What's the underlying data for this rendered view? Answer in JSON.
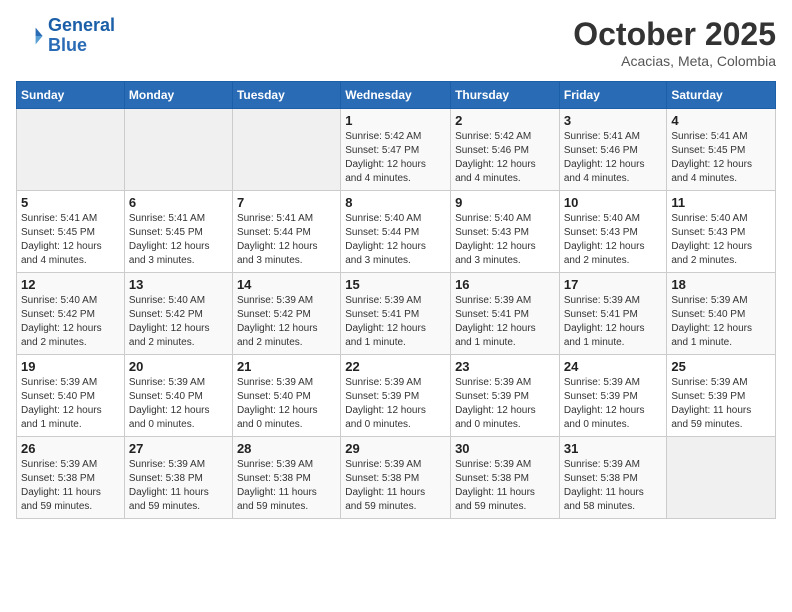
{
  "logo": {
    "line1": "General",
    "line2": "Blue"
  },
  "title": "October 2025",
  "location": "Acacias, Meta, Colombia",
  "weekdays": [
    "Sunday",
    "Monday",
    "Tuesday",
    "Wednesday",
    "Thursday",
    "Friday",
    "Saturday"
  ],
  "weeks": [
    [
      {
        "day": "",
        "info": ""
      },
      {
        "day": "",
        "info": ""
      },
      {
        "day": "",
        "info": ""
      },
      {
        "day": "1",
        "info": "Sunrise: 5:42 AM\nSunset: 5:47 PM\nDaylight: 12 hours\nand 4 minutes."
      },
      {
        "day": "2",
        "info": "Sunrise: 5:42 AM\nSunset: 5:46 PM\nDaylight: 12 hours\nand 4 minutes."
      },
      {
        "day": "3",
        "info": "Sunrise: 5:41 AM\nSunset: 5:46 PM\nDaylight: 12 hours\nand 4 minutes."
      },
      {
        "day": "4",
        "info": "Sunrise: 5:41 AM\nSunset: 5:45 PM\nDaylight: 12 hours\nand 4 minutes."
      }
    ],
    [
      {
        "day": "5",
        "info": "Sunrise: 5:41 AM\nSunset: 5:45 PM\nDaylight: 12 hours\nand 4 minutes."
      },
      {
        "day": "6",
        "info": "Sunrise: 5:41 AM\nSunset: 5:45 PM\nDaylight: 12 hours\nand 3 minutes."
      },
      {
        "day": "7",
        "info": "Sunrise: 5:41 AM\nSunset: 5:44 PM\nDaylight: 12 hours\nand 3 minutes."
      },
      {
        "day": "8",
        "info": "Sunrise: 5:40 AM\nSunset: 5:44 PM\nDaylight: 12 hours\nand 3 minutes."
      },
      {
        "day": "9",
        "info": "Sunrise: 5:40 AM\nSunset: 5:43 PM\nDaylight: 12 hours\nand 3 minutes."
      },
      {
        "day": "10",
        "info": "Sunrise: 5:40 AM\nSunset: 5:43 PM\nDaylight: 12 hours\nand 2 minutes."
      },
      {
        "day": "11",
        "info": "Sunrise: 5:40 AM\nSunset: 5:43 PM\nDaylight: 12 hours\nand 2 minutes."
      }
    ],
    [
      {
        "day": "12",
        "info": "Sunrise: 5:40 AM\nSunset: 5:42 PM\nDaylight: 12 hours\nand 2 minutes."
      },
      {
        "day": "13",
        "info": "Sunrise: 5:40 AM\nSunset: 5:42 PM\nDaylight: 12 hours\nand 2 minutes."
      },
      {
        "day": "14",
        "info": "Sunrise: 5:39 AM\nSunset: 5:42 PM\nDaylight: 12 hours\nand 2 minutes."
      },
      {
        "day": "15",
        "info": "Sunrise: 5:39 AM\nSunset: 5:41 PM\nDaylight: 12 hours\nand 1 minute."
      },
      {
        "day": "16",
        "info": "Sunrise: 5:39 AM\nSunset: 5:41 PM\nDaylight: 12 hours\nand 1 minute."
      },
      {
        "day": "17",
        "info": "Sunrise: 5:39 AM\nSunset: 5:41 PM\nDaylight: 12 hours\nand 1 minute."
      },
      {
        "day": "18",
        "info": "Sunrise: 5:39 AM\nSunset: 5:40 PM\nDaylight: 12 hours\nand 1 minute."
      }
    ],
    [
      {
        "day": "19",
        "info": "Sunrise: 5:39 AM\nSunset: 5:40 PM\nDaylight: 12 hours\nand 1 minute."
      },
      {
        "day": "20",
        "info": "Sunrise: 5:39 AM\nSunset: 5:40 PM\nDaylight: 12 hours\nand 0 minutes."
      },
      {
        "day": "21",
        "info": "Sunrise: 5:39 AM\nSunset: 5:40 PM\nDaylight: 12 hours\nand 0 minutes."
      },
      {
        "day": "22",
        "info": "Sunrise: 5:39 AM\nSunset: 5:39 PM\nDaylight: 12 hours\nand 0 minutes."
      },
      {
        "day": "23",
        "info": "Sunrise: 5:39 AM\nSunset: 5:39 PM\nDaylight: 12 hours\nand 0 minutes."
      },
      {
        "day": "24",
        "info": "Sunrise: 5:39 AM\nSunset: 5:39 PM\nDaylight: 12 hours\nand 0 minutes."
      },
      {
        "day": "25",
        "info": "Sunrise: 5:39 AM\nSunset: 5:39 PM\nDaylight: 11 hours\nand 59 minutes."
      }
    ],
    [
      {
        "day": "26",
        "info": "Sunrise: 5:39 AM\nSunset: 5:38 PM\nDaylight: 11 hours\nand 59 minutes."
      },
      {
        "day": "27",
        "info": "Sunrise: 5:39 AM\nSunset: 5:38 PM\nDaylight: 11 hours\nand 59 minutes."
      },
      {
        "day": "28",
        "info": "Sunrise: 5:39 AM\nSunset: 5:38 PM\nDaylight: 11 hours\nand 59 minutes."
      },
      {
        "day": "29",
        "info": "Sunrise: 5:39 AM\nSunset: 5:38 PM\nDaylight: 11 hours\nand 59 minutes."
      },
      {
        "day": "30",
        "info": "Sunrise: 5:39 AM\nSunset: 5:38 PM\nDaylight: 11 hours\nand 59 minutes."
      },
      {
        "day": "31",
        "info": "Sunrise: 5:39 AM\nSunset: 5:38 PM\nDaylight: 11 hours\nand 58 minutes."
      },
      {
        "day": "",
        "info": ""
      }
    ]
  ]
}
